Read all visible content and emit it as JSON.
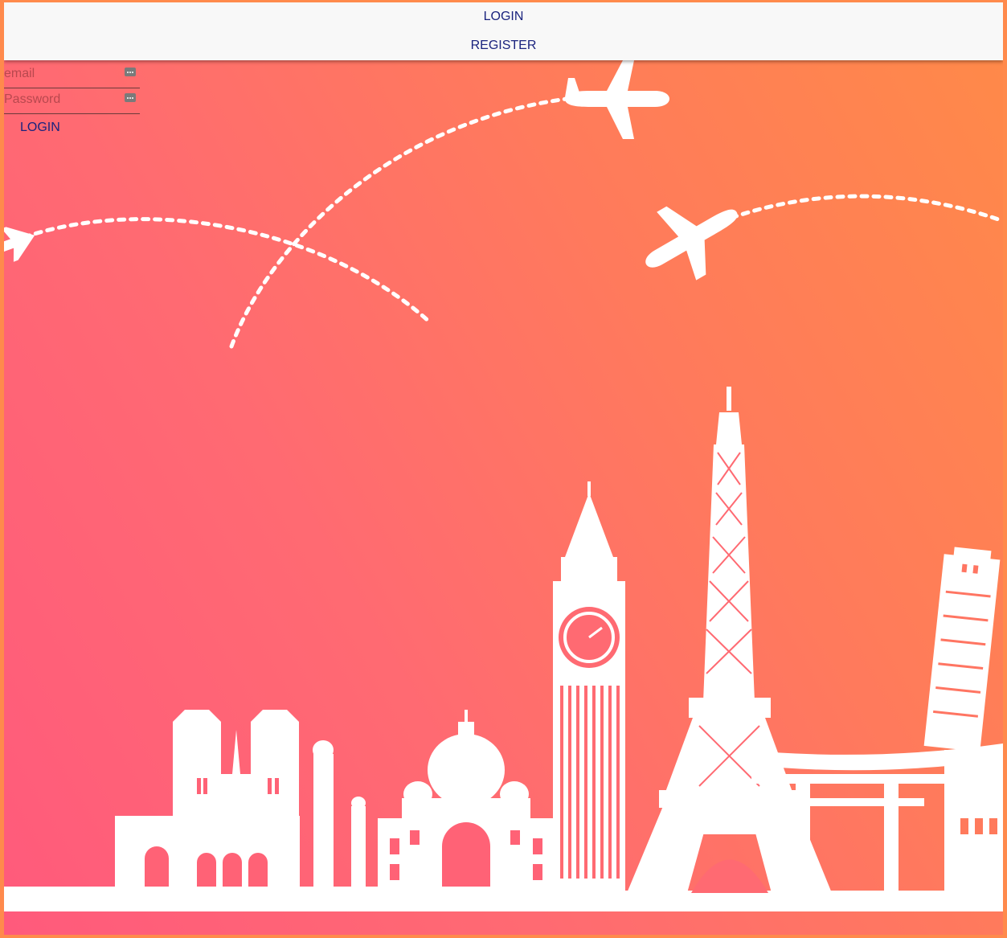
{
  "nav": {
    "login_label": "LOGIN",
    "register_label": "REGISTER"
  },
  "login_form": {
    "email_placeholder": "email",
    "password_placeholder": "Password",
    "submit_label": "LOGIN"
  },
  "icons": {
    "field_icon": "password-manager-key-icon"
  },
  "colors": {
    "nav_text": "#1a237e",
    "background_gradient_start": "#ff5a7c",
    "background_gradient_end": "#ff8a48",
    "illustration": "#ffffff"
  }
}
